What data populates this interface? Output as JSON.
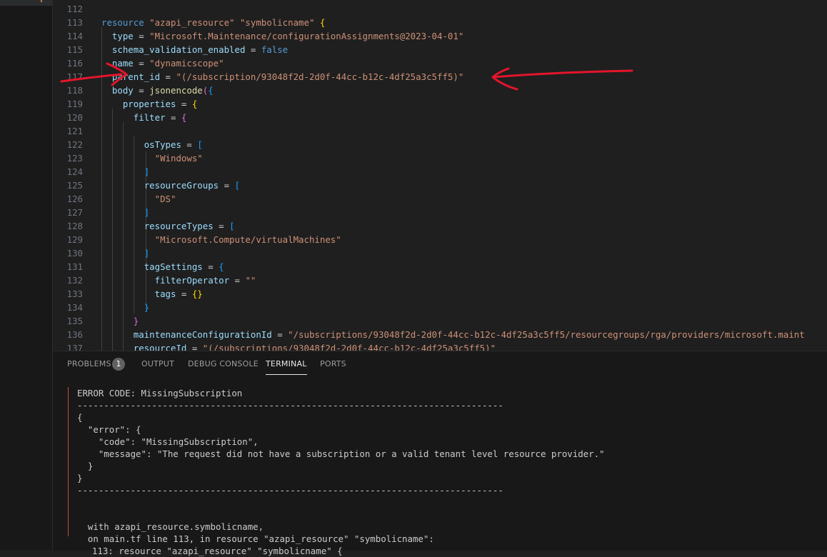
{
  "editor": {
    "lines": [
      {
        "num": "112",
        "tokens": []
      },
      {
        "num": "113",
        "tokens": [
          {
            "t": "resource ",
            "c": "kw"
          },
          {
            "t": "\"azapi_resource\"",
            "c": "str"
          },
          {
            "t": " ",
            "c": "txt"
          },
          {
            "t": "\"symbolicname\"",
            "c": "str"
          },
          {
            "t": " ",
            "c": "txt"
          },
          {
            "t": "{",
            "c": "b1"
          }
        ]
      },
      {
        "num": "114",
        "tokens": [
          {
            "t": "  ",
            "c": "txt"
          },
          {
            "t": "type",
            "c": "attr"
          },
          {
            "t": " = ",
            "c": "txt"
          },
          {
            "t": "\"Microsoft.Maintenance/configurationAssignments@2023-04-01\"",
            "c": "str"
          }
        ]
      },
      {
        "num": "115",
        "tokens": [
          {
            "t": "  ",
            "c": "txt"
          },
          {
            "t": "schema_validation_enabled",
            "c": "attr"
          },
          {
            "t": " = ",
            "c": "txt"
          },
          {
            "t": "false",
            "c": "kw"
          }
        ]
      },
      {
        "num": "116",
        "tokens": [
          {
            "t": "  ",
            "c": "txt"
          },
          {
            "t": "name",
            "c": "attr"
          },
          {
            "t": " = ",
            "c": "txt"
          },
          {
            "t": "\"dynamicscope\"",
            "c": "str"
          }
        ]
      },
      {
        "num": "117",
        "tokens": [
          {
            "t": "  ",
            "c": "txt"
          },
          {
            "t": "parent_id",
            "c": "attr"
          },
          {
            "t": " = ",
            "c": "txt"
          },
          {
            "t": "\"(/subscription/93048f2d-2d0f-44cc-b12c-4df25a3c5ff5)\"",
            "c": "str"
          }
        ]
      },
      {
        "num": "118",
        "tokens": [
          {
            "t": "  ",
            "c": "txt"
          },
          {
            "t": "body",
            "c": "attr"
          },
          {
            "t": " = ",
            "c": "txt"
          },
          {
            "t": "jsonencode",
            "c": "fn"
          },
          {
            "t": "(",
            "c": "b2"
          },
          {
            "t": "{",
            "c": "b3"
          }
        ]
      },
      {
        "num": "119",
        "tokens": [
          {
            "t": "    ",
            "c": "txt"
          },
          {
            "t": "properties",
            "c": "attr"
          },
          {
            "t": " = ",
            "c": "txt"
          },
          {
            "t": "{",
            "c": "b1"
          }
        ]
      },
      {
        "num": "120",
        "tokens": [
          {
            "t": "      ",
            "c": "txt"
          },
          {
            "t": "filter",
            "c": "attr"
          },
          {
            "t": " = ",
            "c": "txt"
          },
          {
            "t": "{",
            "c": "b2"
          }
        ]
      },
      {
        "num": "121",
        "tokens": []
      },
      {
        "num": "122",
        "tokens": [
          {
            "t": "        ",
            "c": "txt"
          },
          {
            "t": "osTypes",
            "c": "attr"
          },
          {
            "t": " = ",
            "c": "txt"
          },
          {
            "t": "[",
            "c": "b3"
          }
        ]
      },
      {
        "num": "123",
        "tokens": [
          {
            "t": "          ",
            "c": "txt"
          },
          {
            "t": "\"Windows\"",
            "c": "str"
          }
        ]
      },
      {
        "num": "124",
        "tokens": [
          {
            "t": "        ",
            "c": "txt"
          },
          {
            "t": "]",
            "c": "b3"
          }
        ]
      },
      {
        "num": "125",
        "tokens": [
          {
            "t": "        ",
            "c": "txt"
          },
          {
            "t": "resourceGroups",
            "c": "attr"
          },
          {
            "t": " = ",
            "c": "txt"
          },
          {
            "t": "[",
            "c": "b3"
          }
        ]
      },
      {
        "num": "126",
        "tokens": [
          {
            "t": "          ",
            "c": "txt"
          },
          {
            "t": "\"DS\"",
            "c": "str"
          }
        ]
      },
      {
        "num": "127",
        "tokens": [
          {
            "t": "        ",
            "c": "txt"
          },
          {
            "t": "]",
            "c": "b3"
          }
        ]
      },
      {
        "num": "128",
        "tokens": [
          {
            "t": "        ",
            "c": "txt"
          },
          {
            "t": "resourceTypes",
            "c": "attr"
          },
          {
            "t": " = ",
            "c": "txt"
          },
          {
            "t": "[",
            "c": "b3"
          }
        ]
      },
      {
        "num": "129",
        "tokens": [
          {
            "t": "          ",
            "c": "txt"
          },
          {
            "t": "\"Microsoft.Compute/virtualMachines\"",
            "c": "str"
          }
        ]
      },
      {
        "num": "130",
        "tokens": [
          {
            "t": "        ",
            "c": "txt"
          },
          {
            "t": "]",
            "c": "b3"
          }
        ]
      },
      {
        "num": "131",
        "tokens": [
          {
            "t": "        ",
            "c": "txt"
          },
          {
            "t": "tagSettings",
            "c": "attr"
          },
          {
            "t": " = ",
            "c": "txt"
          },
          {
            "t": "{",
            "c": "b3"
          }
        ]
      },
      {
        "num": "132",
        "tokens": [
          {
            "t": "          ",
            "c": "txt"
          },
          {
            "t": "filterOperator",
            "c": "attr"
          },
          {
            "t": " = ",
            "c": "txt"
          },
          {
            "t": "\"\"",
            "c": "str"
          }
        ]
      },
      {
        "num": "133",
        "tokens": [
          {
            "t": "          ",
            "c": "txt"
          },
          {
            "t": "tags",
            "c": "attr"
          },
          {
            "t": " = ",
            "c": "txt"
          },
          {
            "t": "{}",
            "c": "b1"
          }
        ]
      },
      {
        "num": "134",
        "tokens": [
          {
            "t": "        ",
            "c": "txt"
          },
          {
            "t": "}",
            "c": "b3"
          }
        ]
      },
      {
        "num": "135",
        "tokens": [
          {
            "t": "      ",
            "c": "txt"
          },
          {
            "t": "}",
            "c": "b2"
          }
        ]
      },
      {
        "num": "136",
        "tokens": [
          {
            "t": "      ",
            "c": "txt"
          },
          {
            "t": "maintenanceConfigurationId",
            "c": "attr"
          },
          {
            "t": " = ",
            "c": "txt"
          },
          {
            "t": "\"/subscriptions/93048f2d-2d0f-44cc-b12c-4df25a3c5ff5/resourcegroups/rga/providers/microsoft.maint",
            "c": "str"
          }
        ]
      },
      {
        "num": "137",
        "tokens": [
          {
            "t": "      ",
            "c": "txt"
          },
          {
            "t": "resourceId",
            "c": "attr"
          },
          {
            "t": " = ",
            "c": "txt"
          },
          {
            "t": "\"(/subscriptions/93048f2d-2d0f-44cc-b12c-4df25a3c5ff5)\"",
            "c": "str"
          }
        ]
      }
    ]
  },
  "panel": {
    "tabs": [
      {
        "label": "PROBLEMS",
        "name": "tab-problems",
        "active": false
      },
      {
        "label": "OUTPUT",
        "name": "tab-output",
        "active": false
      },
      {
        "label": "DEBUG CONSOLE",
        "name": "tab-debug-console",
        "active": false
      },
      {
        "label": "TERMINAL",
        "name": "tab-terminal",
        "active": true
      },
      {
        "label": "PORTS",
        "name": "tab-ports",
        "active": false
      }
    ],
    "problems_count": "1"
  },
  "terminal": {
    "lines": [
      "ERROR CODE: MissingSubscription",
      "--------------------------------------------------------------------------------",
      "{",
      "  \"error\": {",
      "    \"code\": \"MissingSubscription\",",
      "    \"message\": \"The request did not have a subscription or a valid tenant level resource provider.\"",
      "  }",
      "}",
      "--------------------------------------------------------------------------------",
      "",
      "",
      "  with azapi_resource.symbolicname,",
      "  on main.tf line 113, in resource \"azapi_resource\" \"symbolicname\":",
      "  113: resource \"azapi_resource\" \"symbolicname\" {"
    ]
  },
  "colors": {
    "keyword": "#569cd6",
    "string": "#ce9178",
    "attribute": "#9cdcfe",
    "function": "#dcdcaa",
    "error_bar": "#c74e39",
    "annotation_arrow": "#e3152b"
  }
}
